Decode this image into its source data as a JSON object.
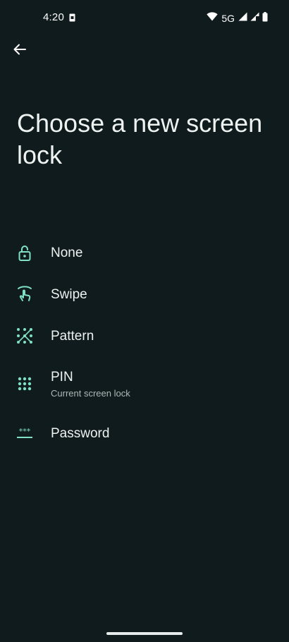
{
  "status_bar": {
    "time": "4:20",
    "network": "5G",
    "icons": [
      "sim-card-icon",
      "wifi-icon",
      "signal-icon",
      "signal-icon",
      "battery-icon"
    ]
  },
  "header": {
    "back_icon": "arrow-back-icon",
    "title": "Choose a new screen lock"
  },
  "options": [
    {
      "label": "None",
      "sublabel": "",
      "icon": "lock-open-icon"
    },
    {
      "label": "Swipe",
      "sublabel": "",
      "icon": "swipe-icon"
    },
    {
      "label": "Pattern",
      "sublabel": "",
      "icon": "pattern-icon"
    },
    {
      "label": "PIN",
      "sublabel": "Current screen lock",
      "icon": "pin-dots-icon"
    },
    {
      "label": "Password",
      "sublabel": "",
      "icon": "password-icon"
    }
  ],
  "colors": {
    "background": "#0f1b1d",
    "accent": "#7fe0c3",
    "text": "#eef2f1",
    "subtext": "#aeb9b7"
  }
}
